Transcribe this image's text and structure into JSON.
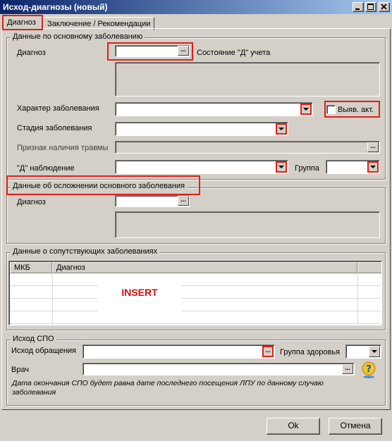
{
  "window": {
    "title": "Исход-диагнозы (новый)"
  },
  "tabs": [
    {
      "label": "Диагноз",
      "active": true
    },
    {
      "label": "Заключение / Рекомендации",
      "active": false
    }
  ],
  "main_disease": {
    "legend": "Данные по основному заболеванию",
    "diagnosis_label": "Диагноз",
    "diagnosis_value": "",
    "d_status_label": "Состояние \"Д\" учета",
    "character_label": "Характер заболевания",
    "character_value": "",
    "detected_label": "Выяв. акт.",
    "detected_checked": false,
    "stage_label": "Стадия заболевания",
    "stage_value": "",
    "trauma_label": "Признак наличия травмы",
    "d_observation_label": "\"Д\" наблюдение",
    "d_observation_value": "",
    "group_label": "Группа",
    "group_value": ""
  },
  "complication": {
    "legend": "Данные об осложнении основного заболевания",
    "diagnosis_label": "Диагноз",
    "diagnosis_value": ""
  },
  "concomitant": {
    "legend": "Данные о сопутствующих заболеваниях",
    "columns": [
      "МКБ",
      "Диагноз"
    ],
    "rows": [],
    "insert_hint": "INSERT"
  },
  "outcome": {
    "legend": "Исход СПО",
    "outcome_label": "Исход обращения",
    "outcome_value": "",
    "health_group_label": "Группа здоровья",
    "health_group_value": "",
    "doctor_label": "Врач",
    "doctor_value": "",
    "note": "Дата окончания СПО будет равна дате последнего посещения ЛПУ по данному случаю заболевания"
  },
  "buttons": {
    "ok": "Ok",
    "cancel": "Отмена"
  },
  "icons": {
    "minimize": "minimize-icon",
    "maximize": "maximize-icon",
    "close": "close-icon",
    "dropdown": "chevron-down-icon",
    "help": "help-icon"
  },
  "colors": {
    "title_start": "#0a246a",
    "title_end": "#a6caf0",
    "highlight": "#e0201a",
    "insert": "#d01010"
  }
}
